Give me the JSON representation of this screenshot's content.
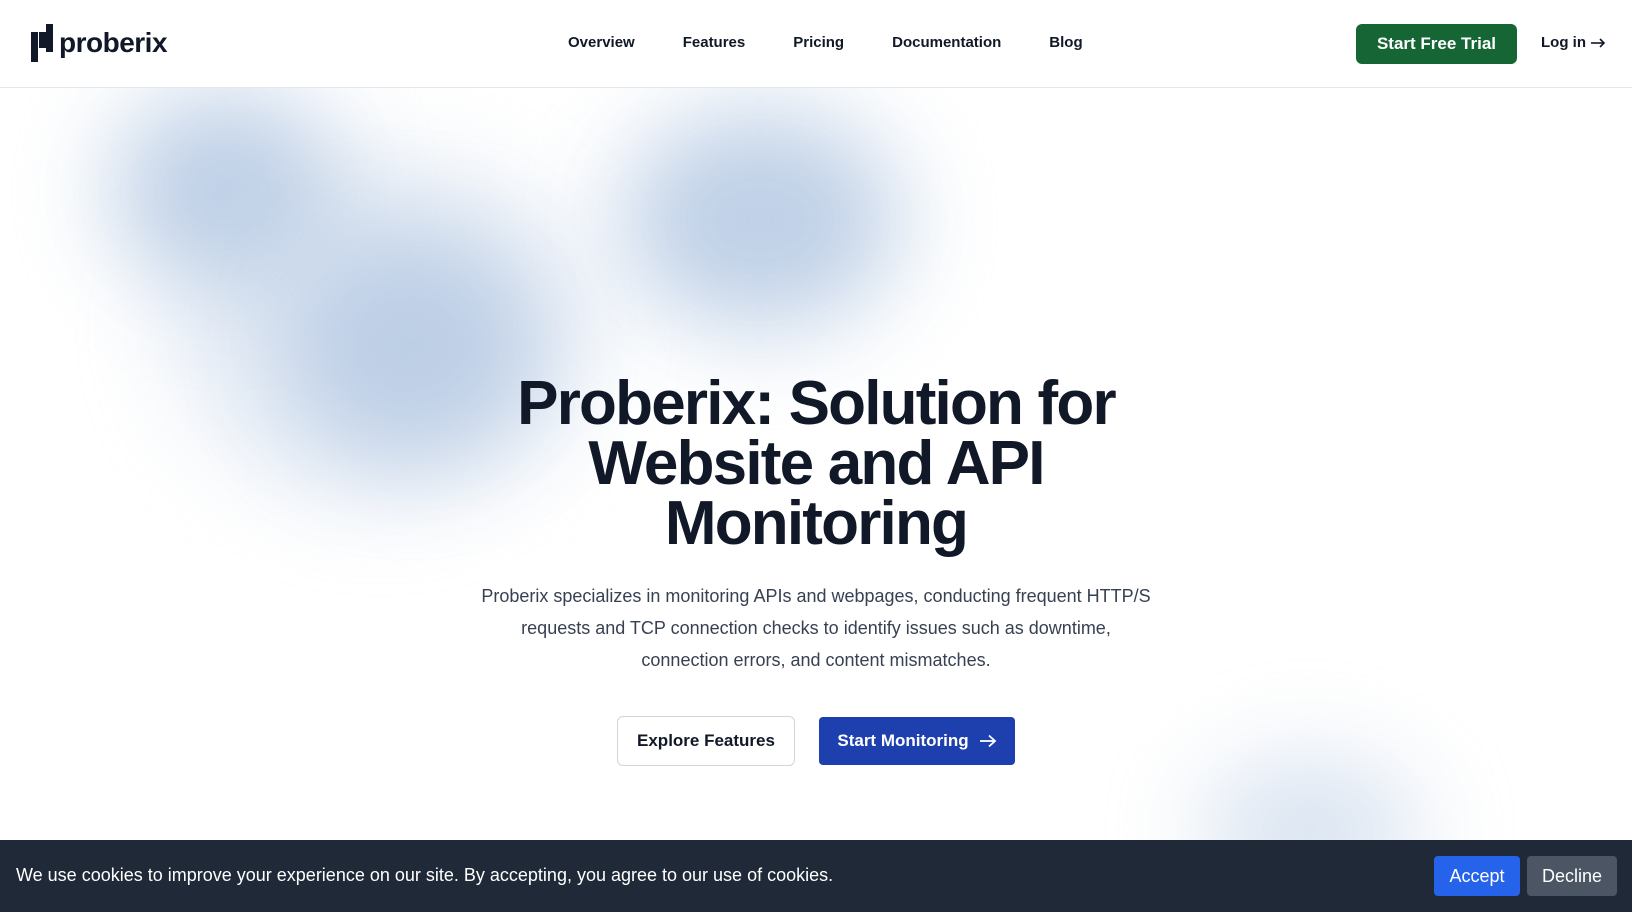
{
  "header": {
    "logo_text": "proberix",
    "nav": [
      {
        "label": "Overview"
      },
      {
        "label": "Features"
      },
      {
        "label": "Pricing"
      },
      {
        "label": "Documentation"
      },
      {
        "label": "Blog"
      }
    ],
    "trial_label": "Start Free Trial",
    "login_label": "Log in",
    "login_icon": "arrow-right-icon"
  },
  "hero": {
    "title": "Proberix: Solution for Website and API Monitoring",
    "subtitle": "Proberix specializes in monitoring APIs and webpages, conducting frequent HTTP/S requests and TCP connection checks to identify issues such as downtime, connection errors, and content mismatches.",
    "explore_label": "Explore Features",
    "monitor_label": "Start Monitoring",
    "monitor_icon": "arrow-right-icon"
  },
  "cookie": {
    "text": "We use cookies to improve your experience on our site. By accepting, you agree to our use of cookies.",
    "accept_label": "Accept",
    "decline_label": "Decline"
  },
  "colors": {
    "trial_button": "#166534",
    "primary_button": "#1e40af",
    "accept_button": "#2563eb",
    "decline_button": "#4b5563",
    "cookie_banner": "#1f2937",
    "blob": "#b8cbe4"
  }
}
